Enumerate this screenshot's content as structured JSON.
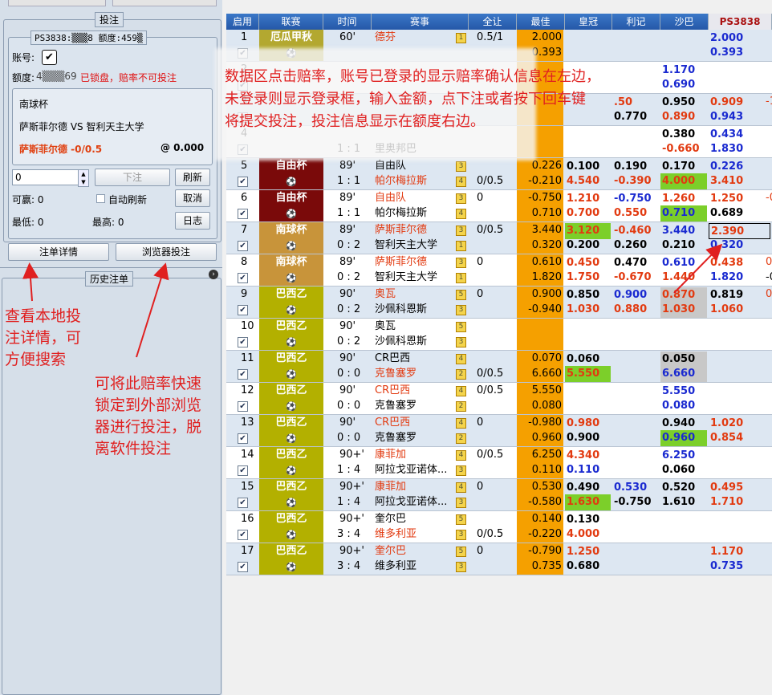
{
  "left": {
    "bet_group_title": "投注",
    "account_line": "PS3838:▒▒▒8 额度:459▒",
    "account_label": "账号:",
    "credit_label": "额度:",
    "credit_value": "4▒▒▒69",
    "locked_msg": "已锁盘，赔率不可投注",
    "match_league": "南球杯",
    "match_teams": "萨斯菲尔德 VS 智利天主大学",
    "bet_selection": "萨斯菲尔德 -0/0.5",
    "bet_odds": "@ 0.000",
    "amount_value": "0",
    "place_bet": "下注",
    "refresh": "刷新",
    "can_win_label": "可赢: 0",
    "auto_refresh": "自动刷新",
    "cancel": "取消",
    "min_label": "最低: 0",
    "max_label": "最高: 0",
    "log": "日志",
    "order_detail": "注单详情",
    "browser_bet": "浏览器投注",
    "history": "历史注单"
  },
  "annotations": {
    "main": [
      "数据区点击赔率，账号已登录的显示赔率确认信息在左边，",
      "未登录则显示登录框，输入金额，点下注或者按下回车键",
      "将提交投注，投注信息显示在额度右边。"
    ],
    "left1": [
      "查看本地投",
      "注详情，可",
      "方便搜索"
    ],
    "left2": [
      "可将此赔率快速",
      "锁定到外部浏览",
      "器进行投注，脱",
      "离软件投注"
    ]
  },
  "columns": [
    "启用",
    "联赛",
    "时间",
    "赛事",
    "全让",
    "最佳",
    "皇冠",
    "利记",
    "沙巴",
    "PS3838"
  ],
  "league_colors": {
    "厄瓜甲秋": "#b3a830",
    "自由杯": "#7a0a0a",
    "南球杯": "#c8943a",
    "巴西乙": "#b3b000"
  },
  "rows": [
    {
      "n": "1",
      "league": "厄瓜甲秋",
      "time": "60'",
      "score": "",
      "t1": "德芬",
      "t1c": "r",
      "h1": "1",
      "t2": "",
      "t2c": "k",
      "h2": "",
      "hcp1": "0.5/1",
      "hcp2": "",
      "best1": "2.000",
      "best2": "0.393",
      "o": [
        [
          "",
          ""
        ],
        [
          "",
          ""
        ],
        [
          "",
          ""
        ],
        [
          "2.000",
          "0.393"
        ]
      ],
      "oc": [
        [
          "",
          ""
        ],
        [
          "",
          ""
        ],
        [
          "",
          ""
        ],
        [
          "b",
          "b"
        ]
      ],
      "extra": [
        "",
        ""
      ]
    },
    {
      "n": "2",
      "league": "",
      "time": "",
      "score": "",
      "t1": "",
      "t1c": "k",
      "h1": "",
      "t2": "",
      "t2c": "k",
      "h2": "",
      "hcp1": "",
      "hcp2": "",
      "best1": "",
      "best2": "",
      "o": [
        [
          "",
          ""
        ],
        [
          "",
          ""
        ],
        [
          "1.170",
          "0.690"
        ],
        [
          "",
          ""
        ]
      ],
      "oc": [
        [
          "",
          ""
        ],
        [
          "",
          ""
        ],
        [
          "b",
          "b"
        ],
        [
          "",
          ""
        ]
      ],
      "extra": [
        "",
        ""
      ]
    },
    {
      "n": "3",
      "league": "",
      "time": "",
      "score": "",
      "t1": "",
      "t1c": "k",
      "h1": "",
      "t2": "",
      "t2c": "k",
      "h2": "",
      "hcp1": "",
      "hcp2": "",
      "best1": "",
      "best2": "",
      "o": [
        [
          "",
          ""
        ],
        [
          ".50",
          "0.770"
        ],
        [
          "0.950",
          "0.890"
        ],
        [
          "0.909",
          "0.943"
        ]
      ],
      "oc": [
        [
          "",
          ""
        ],
        [
          "r",
          "k"
        ],
        [
          "k",
          "r"
        ],
        [
          "r",
          "b"
        ]
      ],
      "extra": [
        "-1",
        ""
      ]
    },
    {
      "n": "4",
      "league": "",
      "time": "",
      "score": "1 : 1",
      "t1": "",
      "t1c": "k",
      "h1": "",
      "t2": "里奥邦巴",
      "t2c": "k",
      "h2": "",
      "hcp1": "",
      "hcp2": "",
      "best1": "",
      "best2": "",
      "o": [
        [
          "",
          ""
        ],
        [
          "",
          ""
        ],
        [
          "0.380",
          "-0.660"
        ],
        [
          "0.434",
          "1.830"
        ]
      ],
      "oc": [
        [
          "",
          ""
        ],
        [
          "",
          ""
        ],
        [
          "k",
          "r"
        ],
        [
          "b",
          "b"
        ]
      ],
      "extra": [
        "",
        ""
      ]
    },
    {
      "n": "5",
      "league": "自由杯",
      "time": "89'",
      "score": "1 : 1",
      "t1": "自由队",
      "t1c": "k",
      "h1": "3",
      "t2": "帕尔梅拉斯",
      "t2c": "r",
      "h2": "4",
      "hcp1": "",
      "hcp2": "0/0.5",
      "best1": "0.226",
      "best2": "-0.210",
      "o": [
        [
          "0.100",
          "4.540"
        ],
        [
          "0.190",
          "-0.390"
        ],
        [
          "0.170",
          "4.000"
        ],
        [
          "0.226",
          "3.410"
        ]
      ],
      "oc": [
        [
          "k",
          "r"
        ],
        [
          "k",
          "r"
        ],
        [
          "k",
          "r"
        ],
        [
          "b",
          "r"
        ]
      ],
      "extra": [
        "",
        ""
      ]
    },
    {
      "n": "6",
      "league": "自由杯",
      "time": "89'",
      "score": "1 : 1",
      "t1": "自由队",
      "t1c": "r",
      "h1": "3",
      "t2": "帕尔梅拉斯",
      "t2c": "k",
      "h2": "4",
      "hcp1": "0",
      "hcp2": "",
      "best1": "-0.750",
      "best2": "0.710",
      "o": [
        [
          "1.210",
          "0.700"
        ],
        [
          "-0.750",
          "0.550"
        ],
        [
          "1.260",
          "0.710"
        ],
        [
          "1.250",
          "0.689"
        ]
      ],
      "oc": [
        [
          "r",
          "r"
        ],
        [
          "b",
          "r"
        ],
        [
          "r",
          "b"
        ],
        [
          "r",
          "k"
        ]
      ],
      "extra": [
        "-0",
        ""
      ]
    },
    {
      "n": "7",
      "league": "南球杯",
      "time": "89'",
      "score": "0 : 2",
      "t1": "萨斯菲尔德",
      "t1c": "r",
      "h1": "3",
      "t2": "智利天主大学",
      "t2c": "k",
      "h2": "1",
      "hcp1": "0/0.5",
      "hcp2": "",
      "best1": "3.440",
      "best2": "0.320",
      "o": [
        [
          "3.120",
          "0.200"
        ],
        [
          "-0.460",
          "0.260"
        ],
        [
          "3.440",
          "0.210"
        ],
        [
          "2.390",
          "0.320"
        ]
      ],
      "oc": [
        [
          "r",
          "k"
        ],
        [
          "r",
          "k"
        ],
        [
          "b",
          "k"
        ],
        [
          "r",
          "b"
        ]
      ],
      "extra": [
        "",
        ""
      ]
    },
    {
      "n": "8",
      "league": "南球杯",
      "time": "89'",
      "score": "0 : 2",
      "t1": "萨斯菲尔德",
      "t1c": "r",
      "h1": "3",
      "t2": "智利天主大学",
      "t2c": "k",
      "h2": "1",
      "hcp1": "0",
      "hcp2": "",
      "best1": "0.610",
      "best2": "1.820",
      "o": [
        [
          "0.450",
          "1.750"
        ],
        [
          "0.470",
          "-0.670"
        ],
        [
          "0.610",
          "1.440"
        ],
        [
          "0.438",
          "1.820"
        ]
      ],
      "oc": [
        [
          "r",
          "r"
        ],
        [
          "k",
          "r"
        ],
        [
          "b",
          "r"
        ],
        [
          "r",
          "b"
        ]
      ],
      "extra": [
        "0",
        "-0"
      ]
    },
    {
      "n": "9",
      "league": "巴西乙",
      "time": "90'",
      "score": "0 : 2",
      "t1": "奥瓦",
      "t1c": "r",
      "h1": "5",
      "t2": "沙佩科恩斯",
      "t2c": "k",
      "h2": "3",
      "hcp1": "0",
      "hcp2": "",
      "best1": "0.900",
      "best2": "-0.940",
      "o": [
        [
          "0.850",
          "1.030"
        ],
        [
          "0.900",
          "0.880"
        ],
        [
          "0.870",
          "1.030"
        ],
        [
          "0.819",
          "1.060"
        ]
      ],
      "oc": [
        [
          "k",
          "r"
        ],
        [
          "b",
          "r"
        ],
        [
          "r",
          "r"
        ],
        [
          "k",
          "r"
        ]
      ],
      "extra": [
        "0",
        ""
      ]
    },
    {
      "n": "10",
      "league": "巴西乙",
      "time": "90'",
      "score": "0 : 2",
      "t1": "奥瓦",
      "t1c": "k",
      "h1": "5",
      "t2": "沙佩科恩斯",
      "t2c": "k",
      "h2": "3",
      "hcp1": "",
      "hcp2": "",
      "best1": "",
      "best2": "",
      "o": [
        [
          "",
          ""
        ],
        [
          "",
          ""
        ],
        [
          "",
          ""
        ],
        [
          "",
          ""
        ]
      ],
      "oc": [
        [
          "",
          ""
        ],
        [
          "",
          ""
        ],
        [
          "",
          ""
        ],
        [
          "",
          ""
        ]
      ],
      "extra": [
        "",
        ""
      ]
    },
    {
      "n": "11",
      "league": "巴西乙",
      "time": "90'",
      "score": "0 : 0",
      "t1": "CR巴西",
      "t1c": "k",
      "h1": "4",
      "t2": "克鲁塞罗",
      "t2c": "r",
      "h2": "2",
      "hcp1": "",
      "hcp2": "0/0.5",
      "best1": "0.070",
      "best2": "6.660",
      "o": [
        [
          "0.060",
          "5.550"
        ],
        [
          "",
          ""
        ],
        [
          "0.050",
          "6.660"
        ],
        [
          "",
          ""
        ]
      ],
      "oc": [
        [
          "k",
          "r"
        ],
        [
          "",
          ""
        ],
        [
          "k",
          "b"
        ],
        [
          "",
          ""
        ]
      ],
      "extra": [
        "",
        ""
      ]
    },
    {
      "n": "12",
      "league": "巴西乙",
      "time": "90'",
      "score": "0 : 0",
      "t1": "CR巴西",
      "t1c": "r",
      "h1": "4",
      "t2": "克鲁塞罗",
      "t2c": "k",
      "h2": "2",
      "hcp1": "0/0.5",
      "hcp2": "",
      "best1": "5.550",
      "best2": "0.080",
      "o": [
        [
          "",
          ""
        ],
        [
          "",
          ""
        ],
        [
          "5.550",
          "0.080"
        ],
        [
          "",
          ""
        ]
      ],
      "oc": [
        [
          "",
          ""
        ],
        [
          "",
          ""
        ],
        [
          "b",
          "b"
        ],
        [
          "",
          ""
        ]
      ],
      "extra": [
        "",
        ""
      ]
    },
    {
      "n": "13",
      "league": "巴西乙",
      "time": "90'",
      "score": "0 : 0",
      "t1": "CR巴西",
      "t1c": "r",
      "h1": "4",
      "t2": "克鲁塞罗",
      "t2c": "k",
      "h2": "2",
      "hcp1": "0",
      "hcp2": "",
      "best1": "-0.980",
      "best2": "0.960",
      "o": [
        [
          "0.980",
          "0.900"
        ],
        [
          "",
          ""
        ],
        [
          "0.940",
          "0.960"
        ],
        [
          "1.020",
          "0.854"
        ]
      ],
      "oc": [
        [
          "r",
          "k"
        ],
        [
          "",
          ""
        ],
        [
          "k",
          "b"
        ],
        [
          "r",
          "r"
        ]
      ],
      "extra": [
        "",
        ""
      ]
    },
    {
      "n": "14",
      "league": "巴西乙",
      "time": "90+'",
      "score": "1 : 4",
      "t1": "康菲加",
      "t1c": "r",
      "h1": "4",
      "t2": "阿拉戈亚诺体...",
      "t2c": "k",
      "h2": "3",
      "hcp1": "0/0.5",
      "hcp2": "",
      "best1": "6.250",
      "best2": "0.110",
      "o": [
        [
          "4.340",
          "0.110"
        ],
        [
          "",
          ""
        ],
        [
          "6.250",
          "0.060"
        ],
        [
          "",
          ""
        ]
      ],
      "oc": [
        [
          "r",
          "b"
        ],
        [
          "",
          ""
        ],
        [
          "b",
          "k"
        ],
        [
          "",
          ""
        ]
      ],
      "extra": [
        "",
        ""
      ]
    },
    {
      "n": "15",
      "league": "巴西乙",
      "time": "90+'",
      "score": "1 : 4",
      "t1": "康菲加",
      "t1c": "r",
      "h1": "4",
      "t2": "阿拉戈亚诺体...",
      "t2c": "k",
      "h2": "3",
      "hcp1": "0",
      "hcp2": "",
      "best1": "0.530",
      "best2": "-0.580",
      "o": [
        [
          "0.490",
          "1.630"
        ],
        [
          "0.530",
          "-0.750"
        ],
        [
          "0.520",
          "1.610"
        ],
        [
          "0.495",
          "1.710"
        ]
      ],
      "oc": [
        [
          "k",
          "r"
        ],
        [
          "b",
          "k"
        ],
        [
          "k",
          "k"
        ],
        [
          "r",
          "r"
        ]
      ],
      "extra": [
        "",
        ""
      ]
    },
    {
      "n": "16",
      "league": "巴西乙",
      "time": "90+'",
      "score": "3 : 4",
      "t1": "奎尔巴",
      "t1c": "k",
      "h1": "5",
      "t2": "维多利亚",
      "t2c": "r",
      "h2": "3",
      "hcp1": "",
      "hcp2": "0/0.5",
      "best1": "0.140",
      "best2": "-0.220",
      "o": [
        [
          "0.130",
          "4.000"
        ],
        [
          "",
          ""
        ],
        [
          "",
          ""
        ],
        [
          "",
          ""
        ]
      ],
      "oc": [
        [
          "k",
          "r"
        ],
        [
          "",
          ""
        ],
        [
          "",
          ""
        ],
        [
          "",
          ""
        ]
      ],
      "extra": [
        "",
        ""
      ]
    },
    {
      "n": "17",
      "league": "巴西乙",
      "time": "90+'",
      "score": "3 : 4",
      "t1": "奎尔巴",
      "t1c": "r",
      "h1": "5",
      "t2": "维多利亚",
      "t2c": "k",
      "h2": "3",
      "hcp1": "0",
      "hcp2": "",
      "best1": "-0.790",
      "best2": "0.735",
      "o": [
        [
          "1.250",
          "0.680"
        ],
        [
          "",
          ""
        ],
        [
          "",
          ""
        ],
        [
          "1.170",
          "0.735"
        ]
      ],
      "oc": [
        [
          "r",
          "k"
        ],
        [
          "",
          ""
        ],
        [
          "",
          ""
        ],
        [
          "r",
          "b"
        ]
      ],
      "extra": [
        "",
        ""
      ]
    }
  ],
  "highlight": {
    "green": [
      [
        4,
        2,
        1
      ],
      [
        6,
        0,
        0
      ],
      [
        5,
        2,
        1
      ],
      [
        10,
        0,
        1
      ],
      [
        12,
        2,
        1
      ],
      [
        14,
        0,
        1
      ]
    ],
    "gray": [
      [
        8,
        2,
        0
      ],
      [
        8,
        2,
        1
      ],
      [
        10,
        2,
        0
      ],
      [
        10,
        2,
        1
      ]
    ],
    "boxed": [
      6,
      3,
      0
    ]
  }
}
